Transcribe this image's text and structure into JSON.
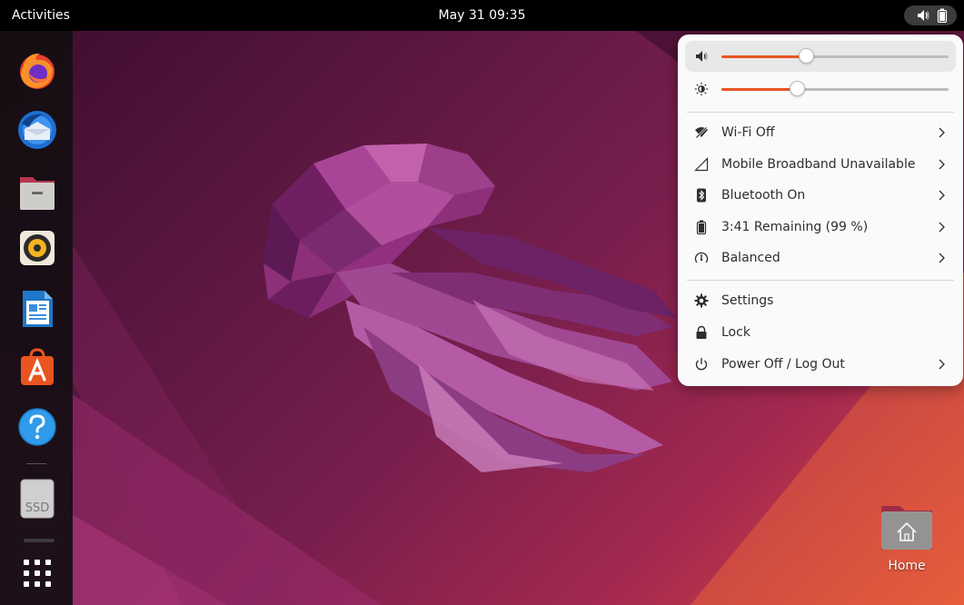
{
  "top_bar": {
    "activities_label": "Activities",
    "clock": "May 31  09:35"
  },
  "dock": {
    "items": [
      {
        "name": "firefox",
        "icon": "firefox-icon"
      },
      {
        "name": "thunderbird",
        "icon": "thunderbird-icon"
      },
      {
        "name": "files",
        "icon": "files-icon"
      },
      {
        "name": "rhythmbox",
        "icon": "rhythmbox-icon"
      },
      {
        "name": "libreoffice-writer",
        "icon": "writer-icon"
      },
      {
        "name": "app-center",
        "icon": "app-center-icon"
      },
      {
        "name": "help",
        "icon": "help-icon"
      },
      {
        "name": "ssd",
        "icon": "drive-icon",
        "label": "SSD"
      },
      {
        "name": "show-apps",
        "icon": "app-grid-icon"
      }
    ]
  },
  "desktop": {
    "home_label": "Home"
  },
  "quick_menu": {
    "volume": {
      "level": 0.37,
      "icon": "speaker-icon"
    },
    "brightness": {
      "level": 0.33,
      "icon": "brightness-icon"
    },
    "items": [
      {
        "label": "Wi-Fi Off",
        "icon": "wifi-off-icon",
        "chevron": true
      },
      {
        "label": "Mobile Broadband Unavailable",
        "icon": "mobile-broadband-icon",
        "chevron": true
      },
      {
        "label": "Bluetooth On",
        "icon": "bluetooth-icon",
        "chevron": true
      },
      {
        "label": "3:41 Remaining (99 %)",
        "icon": "battery-icon",
        "chevron": true
      },
      {
        "label": "Balanced",
        "icon": "power-profile-icon",
        "chevron": true
      },
      {
        "label": "Settings",
        "icon": "gear-icon",
        "chevron": false
      },
      {
        "label": "Lock",
        "icon": "lock-icon",
        "chevron": false
      },
      {
        "label": "Power Off / Log Out",
        "icon": "power-icon",
        "chevron": true
      }
    ]
  },
  "colors": {
    "accent": "#e95420",
    "top_bar": "#000000",
    "menu_bg": "#fafafa"
  }
}
